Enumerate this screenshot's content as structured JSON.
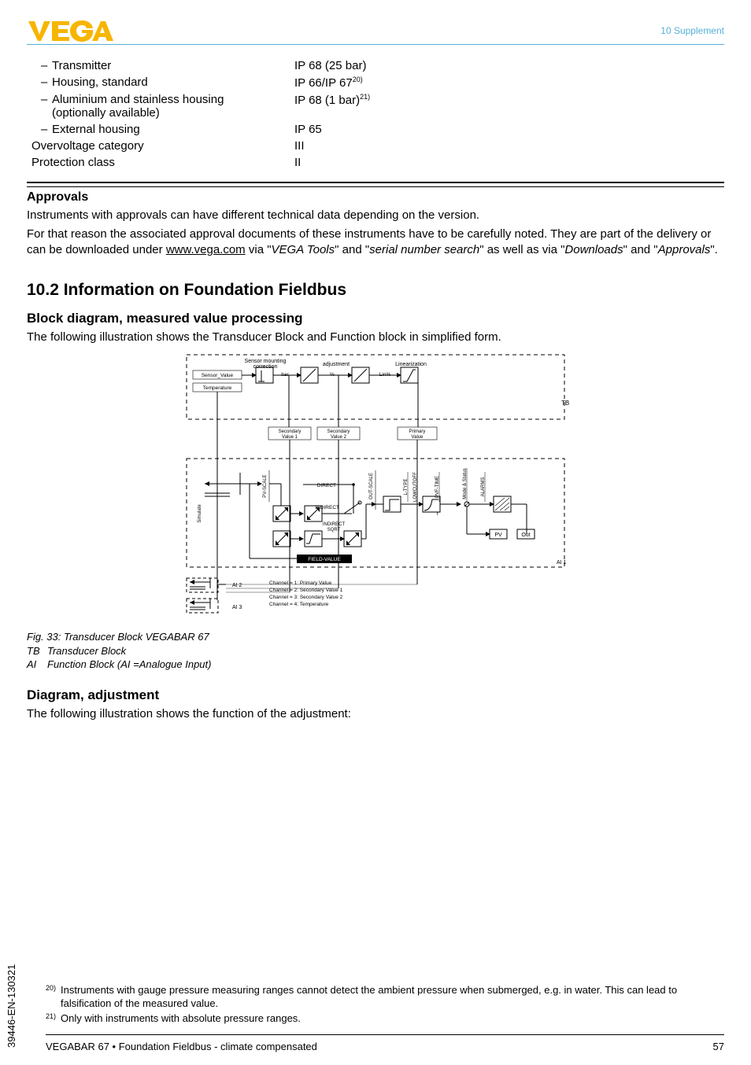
{
  "header": {
    "right": "10 Supplement"
  },
  "logo": {
    "text": "VEGA"
  },
  "specs": {
    "transmitter": {
      "label": "Transmitter",
      "value": "IP 68 (25 bar)"
    },
    "housing_std": {
      "label": "Housing, standard",
      "value_prefix": "IP 66/IP 67",
      "value_sup": "20)"
    },
    "alu": {
      "label1": "Aluminium and stainless housing",
      "label2": "(optionally available)",
      "value_prefix": "IP 68 (1 bar)",
      "value_sup": "21)"
    },
    "ext": {
      "label": "External housing",
      "value": "IP 65"
    },
    "ovc": {
      "label": "Overvoltage category",
      "value": "III"
    },
    "pc": {
      "label": "Protection class",
      "value": "II"
    }
  },
  "approvals": {
    "heading": "Approvals",
    "p1": "Instruments with approvals can have different technical data depending on the version.",
    "p2a": "For that reason the associated approval documents of these instruments have to be carefully noted. They are part of the delivery or can be downloaded under ",
    "p2_link": "www.vega.com",
    "p2b": " via \"",
    "p2_i1": "VEGA Tools",
    "p2c": "\" and \"",
    "p2_i2": "serial number search",
    "p2d": "\" as well as via \"",
    "p2_i3": "Downloads",
    "p2e": "\" and \"",
    "p2_i4": "Approvals",
    "p2f": "\"."
  },
  "sec_10_2": {
    "heading": "10.2   Information on Foundation Fieldbus",
    "block_h": "Block diagram, measured value processing",
    "block_intro": "The following illustration shows the Transducer Block and Function block in simplified form.",
    "caption_title": "Fig. 33: Transducer Block VEGABAR 67",
    "caption_l1_code": "TB",
    "caption_l1_text": "Transducer Block",
    "caption_l2_code": "AI",
    "caption_l2_text": "Function Block (AI =Analogue Input)",
    "adj_h": "Diagram, adjustment",
    "adj_intro": "The following illustration shows the function of the adjustment:"
  },
  "diagram": {
    "sensor_mounting_correction": "Sensor mounting\ncorrection",
    "adjustment": "adjustment",
    "linearization": "Linearization",
    "sensor_value": "Sensor_Value",
    "temperature": "Temperature",
    "bar": "bar",
    "pct": "%",
    "linpct": "Lin%",
    "tb": "TB",
    "sv1": "Secondary\nValue 1",
    "sv2": "Secondary\nValue 2",
    "pv": "Primary\nValue",
    "simulate": "Simulate",
    "pv_scale": "PV-SCALE",
    "direct": "DIRECT",
    "indirect": "INDIRECT",
    "indirect_sqrt": "INDIRECT\nSQRT",
    "out_scale": "OUT-SCALE",
    "ltype": "L-TYPE",
    "lowcutoff": "LOWCUTOFF",
    "pvftime": "PVF-TIME",
    "mode_status": "Mode & Status",
    "alarms": "ALARMS",
    "t": "t",
    "pv_box": "PV",
    "out_box": "Out",
    "field_value": "FIELD-VALUE",
    "ai1": "AI 1",
    "ai2": "AI 2",
    "ai3": "AI 3",
    "ch1": "Channel = 1: Primary Value",
    "ch2": "Channel = 2: Secondary Value 1",
    "ch3": "Channel = 3: Secondary Value 2",
    "ch4": "Channel = 4: Temperature"
  },
  "footnotes": {
    "f20_num": "20)",
    "f20": "Instruments with gauge pressure measuring ranges cannot detect the ambient pressure when submerged, e.g. in water. This can lead to falsification of the measured value.",
    "f21_num": "21)",
    "f21": "Only with instruments with absolute pressure ranges."
  },
  "footer": {
    "left": "VEGABAR 67 • Foundation Fieldbus - climate compensated",
    "right": "57"
  },
  "side_id": "39446-EN-130321"
}
